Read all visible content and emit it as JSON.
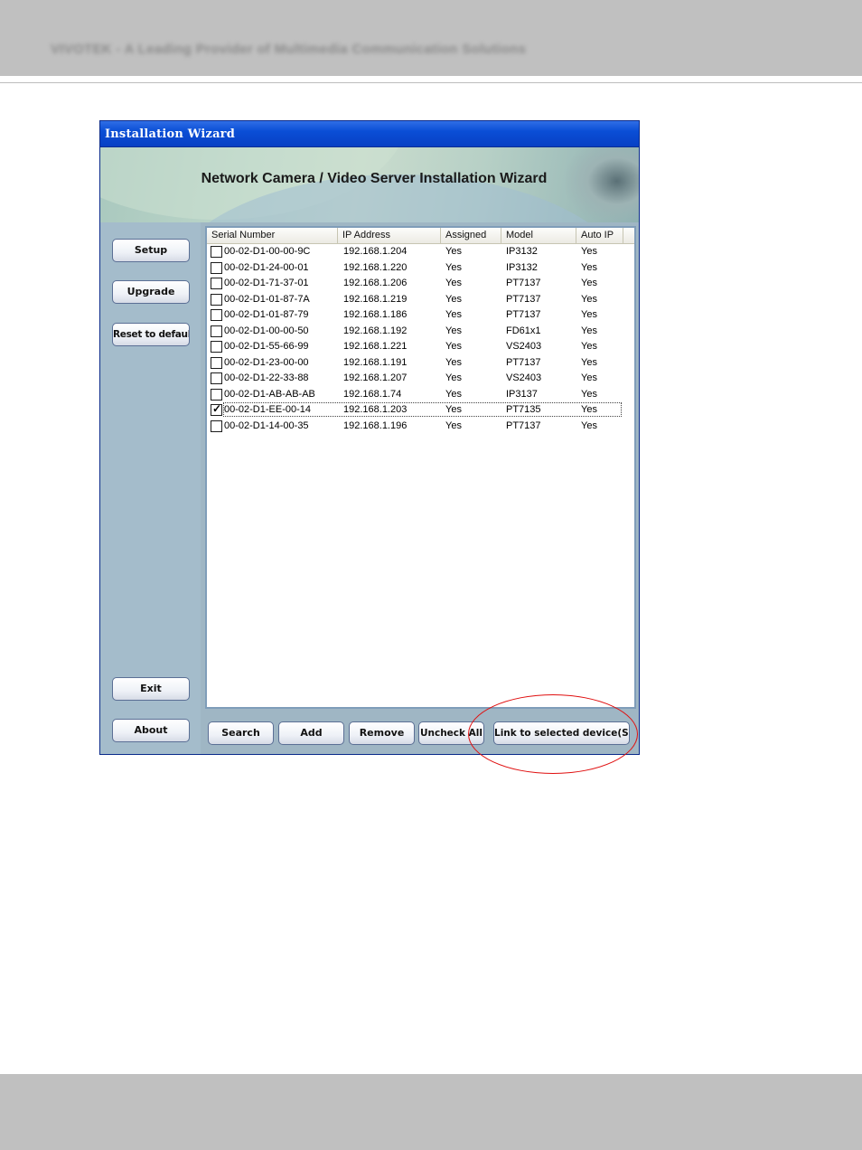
{
  "page": {
    "header_text": "VIVOTEK - A Leading Provider of Multimedia Communication Solutions"
  },
  "window": {
    "title": "Installation Wizard",
    "banner_title": "Network Camera / Video Server Installation Wizard"
  },
  "sidebar": {
    "setup": "Setup",
    "upgrade": "Upgrade",
    "reset": "Reset to default",
    "exit": "Exit",
    "about": "About"
  },
  "table": {
    "columns": [
      "Serial Number",
      "IP Address",
      "Assigned",
      "Model",
      "Auto IP"
    ],
    "rows": [
      {
        "serial": "00-02-D1-00-00-9C",
        "ip": "192.168.1.204",
        "assigned": "Yes",
        "model": "IP3132",
        "auto_ip": "Yes",
        "checked": false
      },
      {
        "serial": "00-02-D1-24-00-01",
        "ip": "192.168.1.220",
        "assigned": "Yes",
        "model": "IP3132",
        "auto_ip": "Yes",
        "checked": false
      },
      {
        "serial": "00-02-D1-71-37-01",
        "ip": "192.168.1.206",
        "assigned": "Yes",
        "model": "PT7137",
        "auto_ip": "Yes",
        "checked": false
      },
      {
        "serial": "00-02-D1-01-87-7A",
        "ip": "192.168.1.219",
        "assigned": "Yes",
        "model": "PT7137",
        "auto_ip": "Yes",
        "checked": false
      },
      {
        "serial": "00-02-D1-01-87-79",
        "ip": "192.168.1.186",
        "assigned": "Yes",
        "model": "PT7137",
        "auto_ip": "Yes",
        "checked": false
      },
      {
        "serial": "00-02-D1-00-00-50",
        "ip": "192.168.1.192",
        "assigned": "Yes",
        "model": "FD61x1",
        "auto_ip": "Yes",
        "checked": false
      },
      {
        "serial": "00-02-D1-55-66-99",
        "ip": "192.168.1.221",
        "assigned": "Yes",
        "model": "VS2403",
        "auto_ip": "Yes",
        "checked": false
      },
      {
        "serial": "00-02-D1-23-00-00",
        "ip": "192.168.1.191",
        "assigned": "Yes",
        "model": "PT7137",
        "auto_ip": "Yes",
        "checked": false
      },
      {
        "serial": "00-02-D1-22-33-88",
        "ip": "192.168.1.207",
        "assigned": "Yes",
        "model": "VS2403",
        "auto_ip": "Yes",
        "checked": false
      },
      {
        "serial": "00-02-D1-AB-AB-AB",
        "ip": "192.168.1.74",
        "assigned": "Yes",
        "model": "IP3137",
        "auto_ip": "Yes",
        "checked": false
      },
      {
        "serial": "00-02-D1-EE-00-14",
        "ip": "192.168.1.203",
        "assigned": "Yes",
        "model": "PT7135",
        "auto_ip": "Yes",
        "checked": true
      },
      {
        "serial": "00-02-D1-14-00-35",
        "ip": "192.168.1.196",
        "assigned": "Yes",
        "model": "PT7137",
        "auto_ip": "Yes",
        "checked": false
      }
    ]
  },
  "toolbar": {
    "search": "Search",
    "add": "Add",
    "remove": "Remove",
    "uncheck_all": "Uncheck All",
    "link": "Link to selected device(S)"
  },
  "colors": {
    "title_bar": "#0a4ed6",
    "panel": "#a4bccb",
    "highlight": "#e01010"
  }
}
